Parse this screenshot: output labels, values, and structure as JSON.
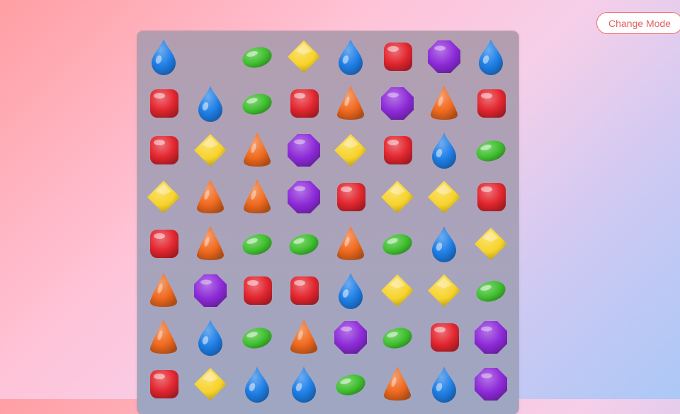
{
  "header": {
    "mode_button_label": "Change Mode"
  },
  "board": {
    "rows": 8,
    "cols": 8,
    "grid": [
      [
        "blue-drop",
        "empty",
        "green-bean",
        "yellow-diamond",
        "blue-drop",
        "red-square",
        "purple-octagon",
        "blue-drop"
      ],
      [
        "red-square",
        "blue-drop",
        "green-bean",
        "red-square",
        "orange-cone",
        "purple-octagon",
        "orange-cone",
        "red-square"
      ],
      [
        "red-square",
        "yellow-diamond",
        "orange-cone",
        "purple-octagon",
        "yellow-diamond",
        "red-square",
        "blue-drop",
        "green-bean"
      ],
      [
        "yellow-diamond",
        "orange-cone",
        "orange-cone",
        "purple-octagon",
        "red-square",
        "yellow-diamond",
        "yellow-diamond",
        "red-square"
      ],
      [
        "red-square",
        "orange-cone",
        "green-bean",
        "green-bean",
        "orange-cone",
        "green-bean",
        "blue-drop",
        "yellow-diamond"
      ],
      [
        "orange-cone",
        "purple-octagon",
        "red-square",
        "red-square",
        "blue-drop",
        "yellow-diamond",
        "yellow-diamond",
        "green-bean"
      ],
      [
        "orange-cone",
        "blue-drop",
        "green-bean",
        "orange-cone",
        "purple-octagon",
        "green-bean",
        "red-square",
        "purple-octagon"
      ],
      [
        "red-square",
        "yellow-diamond",
        "blue-drop",
        "blue-drop",
        "green-bean",
        "orange-cone",
        "blue-drop",
        "purple-octagon"
      ]
    ]
  },
  "colors": {
    "red-square": "#e3262f",
    "blue-drop": "#1f7fe6",
    "green-bean": "#3fbf2e",
    "yellow-diamond": "#f7d32a",
    "orange-cone": "#f06a1e",
    "purple-octagon": "#8d2ad8"
  }
}
